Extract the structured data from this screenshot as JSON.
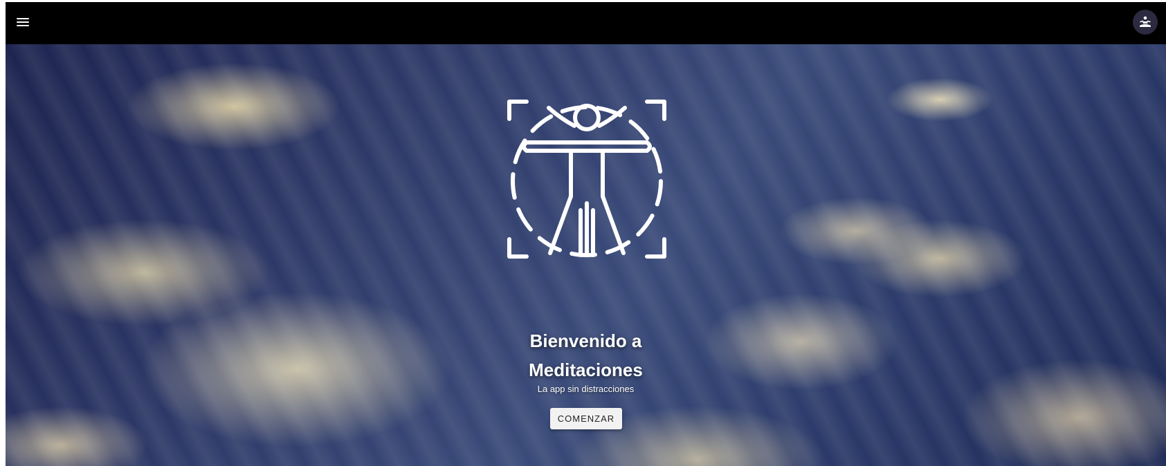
{
  "topbar": {
    "menu_icon": "hamburger-menu-icon",
    "avatar_icon": "meditation-person-icon",
    "background": "#000000"
  },
  "hero": {
    "logo_icon": "vitruvian-man-icon",
    "title_line1": "Bienvenido a",
    "title_line2": "Meditaciones",
    "subtitle": "La app sin distracciones",
    "cta_label": "COMENZAR"
  },
  "colors": {
    "sky_dark": "#1d2450",
    "cloud_light": "#f0e4b9",
    "button_bg": "#f2f2f2",
    "avatar_bg": "#2c2a40"
  }
}
